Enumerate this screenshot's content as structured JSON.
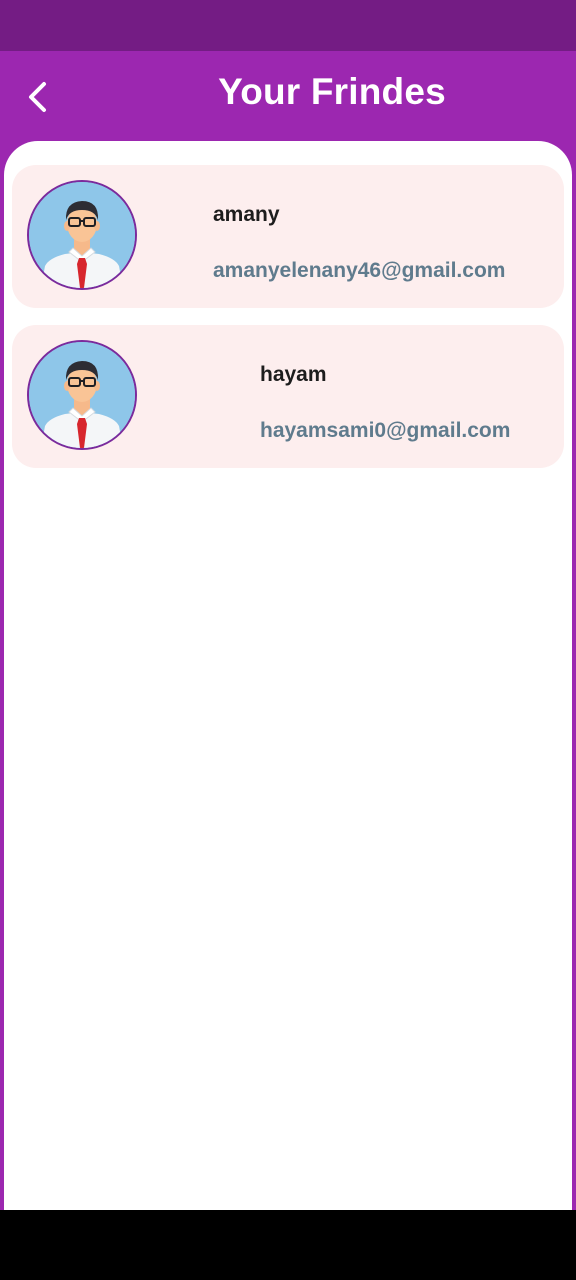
{
  "header": {
    "title": "Your Frindes",
    "back_icon": "chevron-left-icon"
  },
  "friends": [
    {
      "name": "amany",
      "email": "amanyelenany46@gmail.com",
      "avatar_icon": "person-avatar-icon"
    },
    {
      "name": "hayam",
      "email": "hayamsami0@gmail.com",
      "avatar_icon": "person-avatar-icon"
    }
  ],
  "colors": {
    "app_bar": "#9c27b0",
    "status_bar": "#741c84",
    "card_background": "#fdeeee",
    "email_text": "#5f7b8d",
    "avatar_border": "#7b2a9c"
  }
}
